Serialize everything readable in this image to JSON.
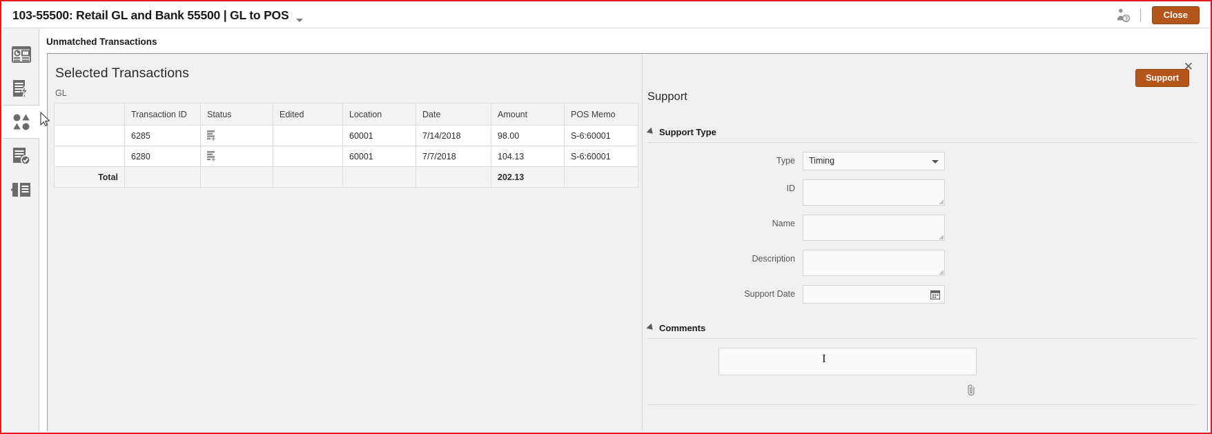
{
  "header": {
    "title": "103-55500: Retail GL and Bank 55500 | GL to POS",
    "caret_icon": "chevron-down-icon",
    "user_icon": "user-badge-icon",
    "close_label": "Close"
  },
  "sidebar": {
    "items": [
      {
        "icon": "dashboard-icon",
        "name": "sidebar-item-dashboard",
        "active": false
      },
      {
        "icon": "document-action-icon",
        "name": "sidebar-item-actions",
        "active": false
      },
      {
        "icon": "shapes-match-icon",
        "name": "sidebar-item-matching",
        "active": true
      },
      {
        "icon": "document-check-icon",
        "name": "sidebar-item-confirmed",
        "active": false
      },
      {
        "icon": "list-detail-icon",
        "name": "sidebar-item-details",
        "active": false
      }
    ]
  },
  "page": {
    "heading": "Unmatched Transactions"
  },
  "dialog": {
    "title": "Selected Transactions",
    "source_label": "GL",
    "close_icon": "close-icon",
    "support_button": "Support",
    "table": {
      "columns": [
        "",
        "Transaction ID",
        "Status",
        "Edited",
        "Location",
        "Date",
        "Amount",
        "POS Memo"
      ],
      "rows": [
        {
          "select": "",
          "transaction_id": "6285",
          "status_icon": "transaction-status-icon",
          "edited": "",
          "location": "60001",
          "date": "7/14/2018",
          "amount": "98.00",
          "pos_memo": "S-6:60001"
        },
        {
          "select": "",
          "transaction_id": "6280",
          "status_icon": "transaction-status-icon",
          "edited": "",
          "location": "60001",
          "date": "7/7/2018",
          "amount": "104.13",
          "pos_memo": "S-6:60001"
        }
      ],
      "total": {
        "label": "Total",
        "amount": "202.13"
      }
    }
  },
  "support": {
    "title": "Support",
    "support_type": {
      "section_label": "Support Type",
      "fields": [
        {
          "label": "Type",
          "value": "Timing",
          "kind": "select",
          "name": "type-select"
        },
        {
          "label": "ID",
          "value": "",
          "kind": "textarea",
          "name": "id-field"
        },
        {
          "label": "Name",
          "value": "",
          "kind": "textarea",
          "name": "name-field"
        },
        {
          "label": "Description",
          "value": "",
          "kind": "textarea",
          "name": "description-field"
        },
        {
          "label": "Support Date",
          "value": "",
          "kind": "date",
          "name": "support-date-field"
        }
      ]
    },
    "comments": {
      "section_label": "Comments",
      "value": "",
      "attach_icon": "paperclip-icon"
    }
  },
  "colors": {
    "accent": "#b4551b",
    "page_border": "#e8171b",
    "panel_bg": "#f0f0f1",
    "grid_line": "#dcdcdc"
  }
}
